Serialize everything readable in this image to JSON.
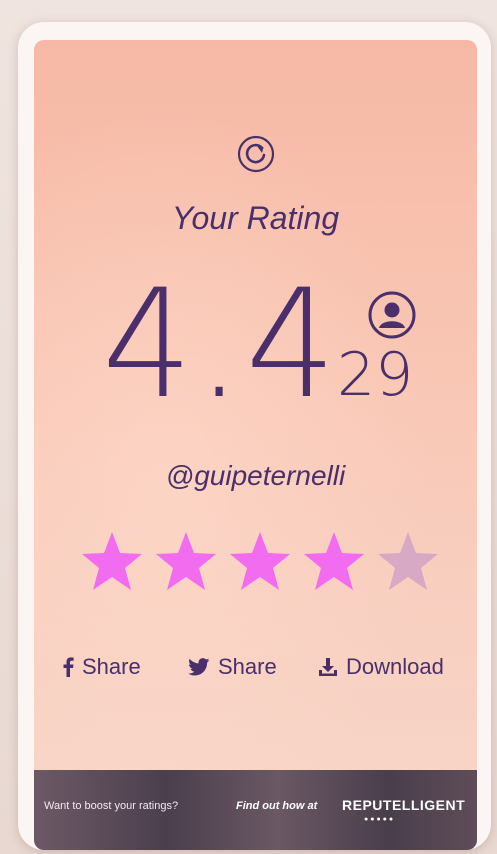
{
  "screen": {
    "title": "Your Rating",
    "rating_value": "4.4",
    "rating_count": "29",
    "username": "@guipeternelli",
    "stars": {
      "total": 5,
      "filled": 4,
      "filled_color": "#f26cf0",
      "empty_color": "#d8a9c4"
    }
  },
  "share_bar": {
    "facebook_label": "Share",
    "twitter_label": "Share",
    "download_label": "Download"
  },
  "promo": {
    "text": "Want to boost your ratings?",
    "cta": "Find out how at",
    "brand": "REPUTELLIGENT"
  },
  "colors": {
    "text": "#4a2f6b",
    "screen_top": "#f6b9a5",
    "screen_bottom": "#f6d7ca"
  },
  "icons": [
    "refresh-icon",
    "user-icon",
    "facebook-icon",
    "twitter-icon",
    "download-icon",
    "star-icon"
  ]
}
